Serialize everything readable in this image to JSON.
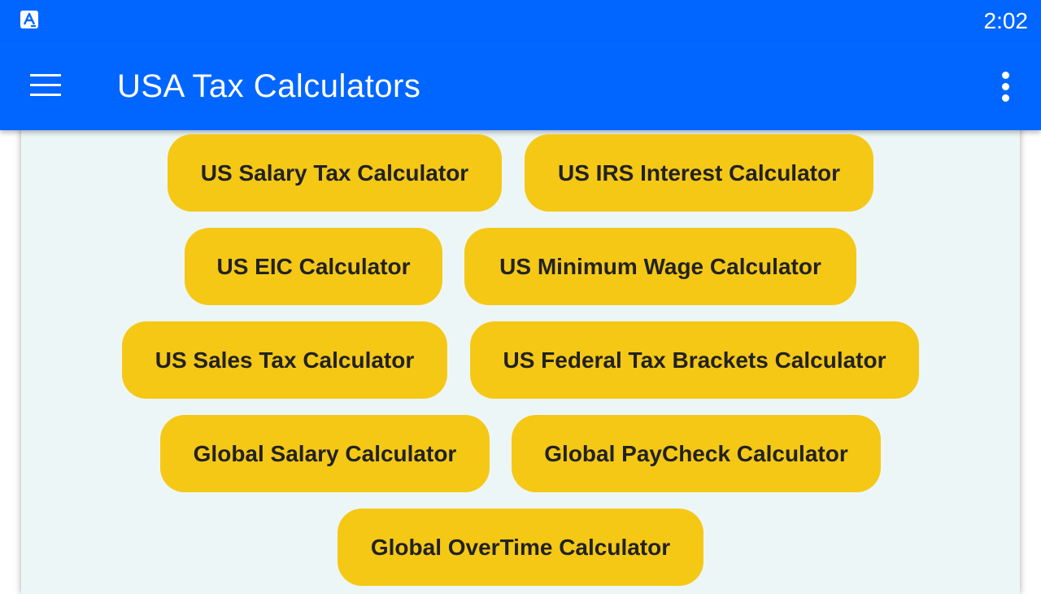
{
  "status_bar": {
    "time": "2:02"
  },
  "app_bar": {
    "title": "USA Tax Calculators",
    "menu_icon": "hamburger-menu-icon",
    "overflow_icon": "more-vert-icon"
  },
  "colors": {
    "primary": "#0066ff",
    "button": "#f5c816",
    "button_text": "#222222",
    "background": "#edf6f7"
  },
  "calculators": [
    "US Salary Tax Calculator",
    "US IRS Interest Calculator",
    "US EIC Calculator",
    "US Minimum Wage Calculator",
    "US Sales Tax Calculator",
    "US Federal Tax Brackets Calculator",
    "Global Salary Calculator",
    "Global PayCheck Calculator",
    "Global OverTime Calculator"
  ]
}
